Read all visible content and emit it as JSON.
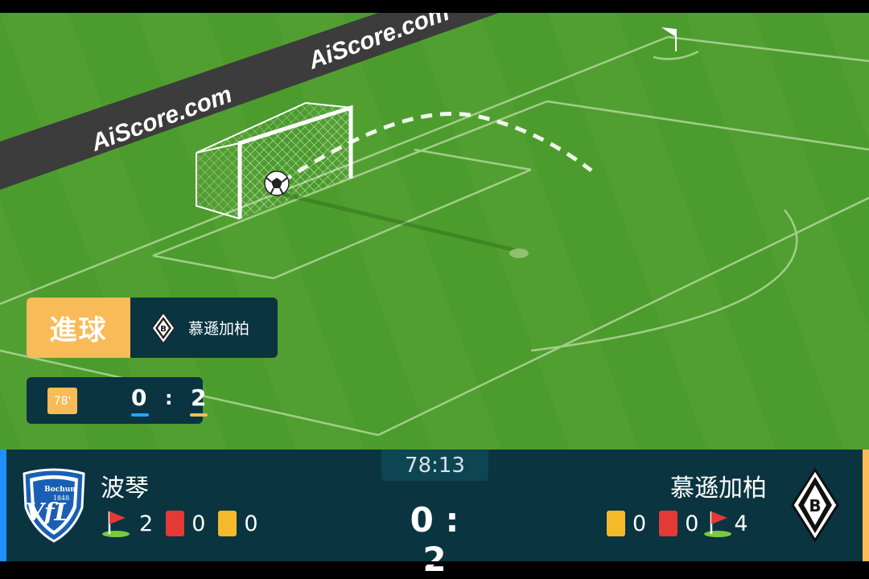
{
  "pitch": {
    "ad_board_texts": [
      "AiScore.com",
      "AiScore.com"
    ],
    "ball_icon": "soccer-ball-icon"
  },
  "event": {
    "type_label": "進球",
    "team_name": "慕遜加柏",
    "team_crest_icon": "gladbach-crest-icon",
    "minute": "78'",
    "score_home": "0",
    "score_sep": ":",
    "score_away": "2"
  },
  "scoreboard": {
    "clock": "78:13",
    "home": {
      "name": "波琴",
      "crest_icon": "bochum-crest-icon",
      "crest_text_top": "Bochum",
      "crest_text_year": "1848",
      "crest_letters": "VfL",
      "corners": "2",
      "red_cards": "0",
      "yellow_cards": "0"
    },
    "away": {
      "name": "慕遜加柏",
      "crest_icon": "gladbach-crest-icon",
      "yellow_cards": "0",
      "red_cards": "0",
      "corners": "4"
    },
    "score": "0 : 2"
  },
  "colors": {
    "pitch_green": "#4a9a2c",
    "panel_dark": "#0a3440",
    "accent_orange": "#f8bb57",
    "home_blue": "#1f8fff",
    "red_card": "#e53935",
    "yellow_card": "#f5b929"
  }
}
